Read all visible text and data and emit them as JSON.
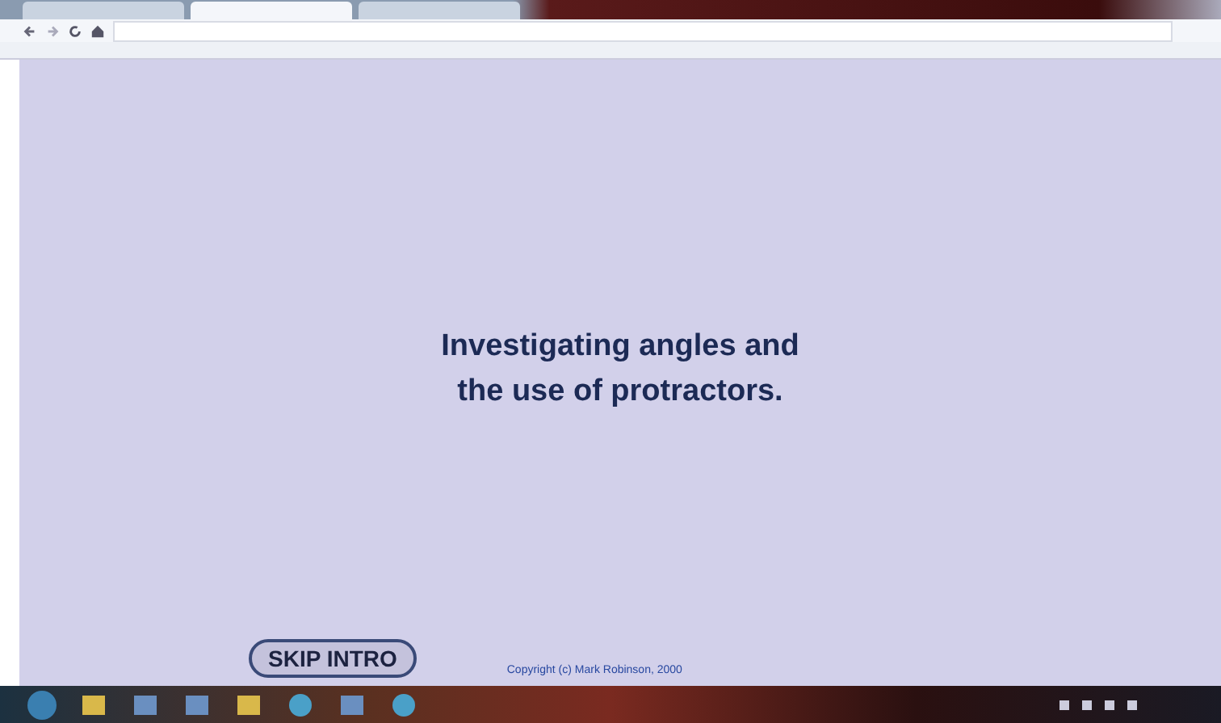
{
  "browser": {
    "tabs": [
      {
        "selected": false
      },
      {
        "selected": true
      },
      {
        "selected": false
      }
    ]
  },
  "page": {
    "title_lines": [
      "Investigating angles and",
      "the use of protractors."
    ],
    "skip_button": "SKIP INTRO",
    "copyright": "Copyright (c) Mark Robinson, 2000"
  },
  "taskbar": {
    "apps": [
      {
        "kind": "folder"
      },
      {
        "kind": "app"
      },
      {
        "kind": "app"
      },
      {
        "kind": "folder"
      },
      {
        "kind": "browser"
      },
      {
        "kind": "app"
      },
      {
        "kind": "browser"
      }
    ]
  }
}
